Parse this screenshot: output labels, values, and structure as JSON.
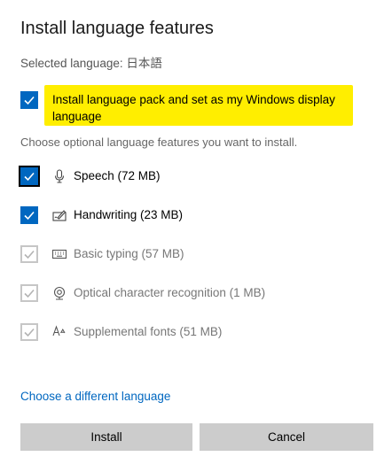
{
  "dialog": {
    "title": "Install language features",
    "selected_language_label": "Selected language:",
    "selected_language_value": "日本語"
  },
  "main_option": {
    "label": "Install language pack and set as my Windows display language",
    "checked": true,
    "highlight_color": "#ffee00"
  },
  "optional": {
    "heading": "Choose optional language features you want to install.",
    "features": [
      {
        "label": "Speech (72 MB)",
        "icon": "microphone-icon",
        "checked": true,
        "enabled": true
      },
      {
        "label": "Handwriting (23 MB)",
        "icon": "pen-icon",
        "checked": true,
        "enabled": true
      },
      {
        "label": "Basic typing (57 MB)",
        "icon": "keyboard-icon",
        "checked": true,
        "enabled": false
      },
      {
        "label": "Optical character recognition (1 MB)",
        "icon": "ocr-icon",
        "checked": true,
        "enabled": false
      },
      {
        "label": "Supplemental fonts (51 MB)",
        "icon": "font-icon",
        "checked": true,
        "enabled": false
      }
    ]
  },
  "links": {
    "choose_different": "Choose a different language"
  },
  "buttons": {
    "install": "Install",
    "cancel": "Cancel"
  },
  "colors": {
    "accent": "#0067c0",
    "button_bg": "#cccccc"
  }
}
